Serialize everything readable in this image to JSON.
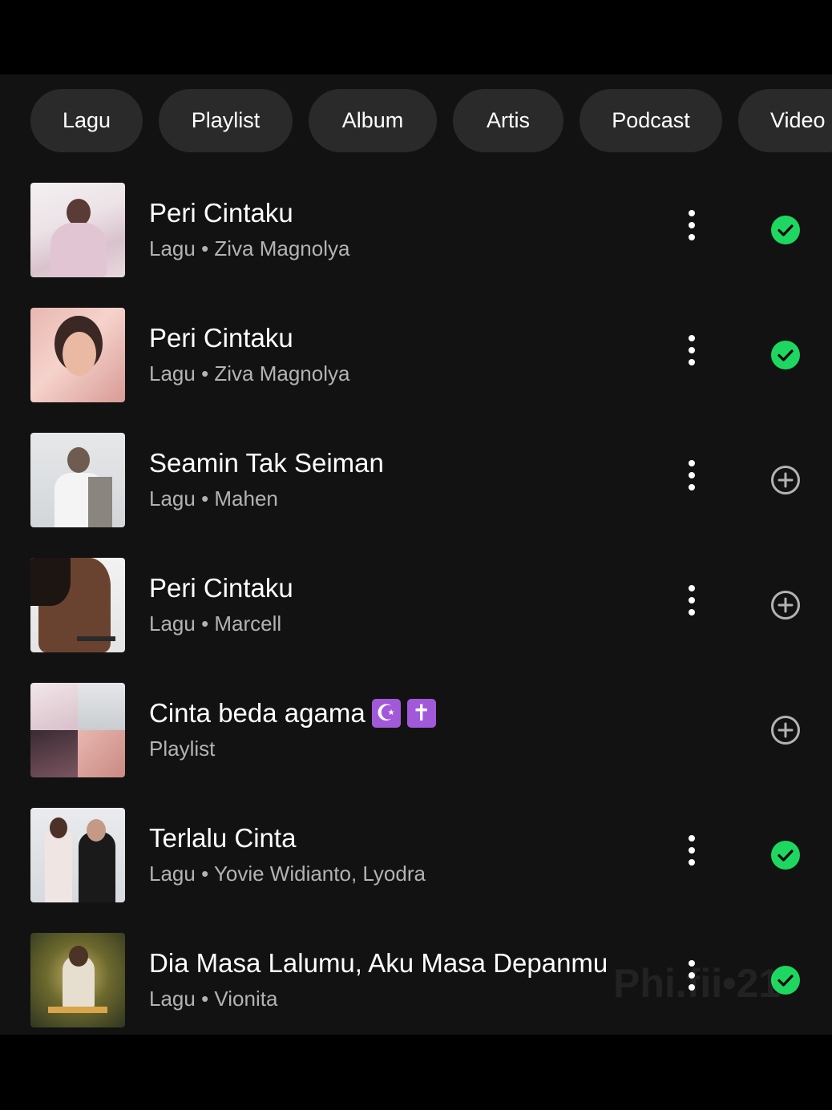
{
  "filters": [
    "Lagu",
    "Playlist",
    "Album",
    "Artis",
    "Podcast",
    "Video"
  ],
  "results": [
    {
      "title": "Peri Cintaku",
      "subtitle": "Lagu • Ziva Magnolya",
      "status": "saved",
      "has_menu": true
    },
    {
      "title": "Peri Cintaku",
      "subtitle": "Lagu • Ziva Magnolya",
      "status": "saved",
      "has_menu": true
    },
    {
      "title": "Seamin Tak Seiman",
      "subtitle": "Lagu • Mahen",
      "status": "add",
      "has_menu": true
    },
    {
      "title": "Peri Cintaku",
      "subtitle": "Lagu • Marcell",
      "status": "add",
      "has_menu": true
    },
    {
      "title": "Cinta beda agama",
      "title_emojis": [
        "☪",
        "✝"
      ],
      "subtitle": "Playlist",
      "status": "add",
      "has_menu": false
    },
    {
      "title": "Terlalu Cinta",
      "subtitle": "Lagu • Yovie Widianto, Lyodra",
      "status": "saved",
      "has_menu": true
    },
    {
      "title": "Dia Masa Lalumu, Aku Masa Depanmu",
      "subtitle": "Lagu • Vionita",
      "status": "saved",
      "has_menu": true
    }
  ],
  "watermark": "Phi.fii•21",
  "colors": {
    "accent": "#1ed760",
    "background": "#121212",
    "chip": "#2a2a2a",
    "emoji_box": "#a259d9"
  },
  "icons": {
    "saved": "check-circle-icon",
    "add": "plus-circle-icon",
    "menu": "more-vertical-icon"
  }
}
